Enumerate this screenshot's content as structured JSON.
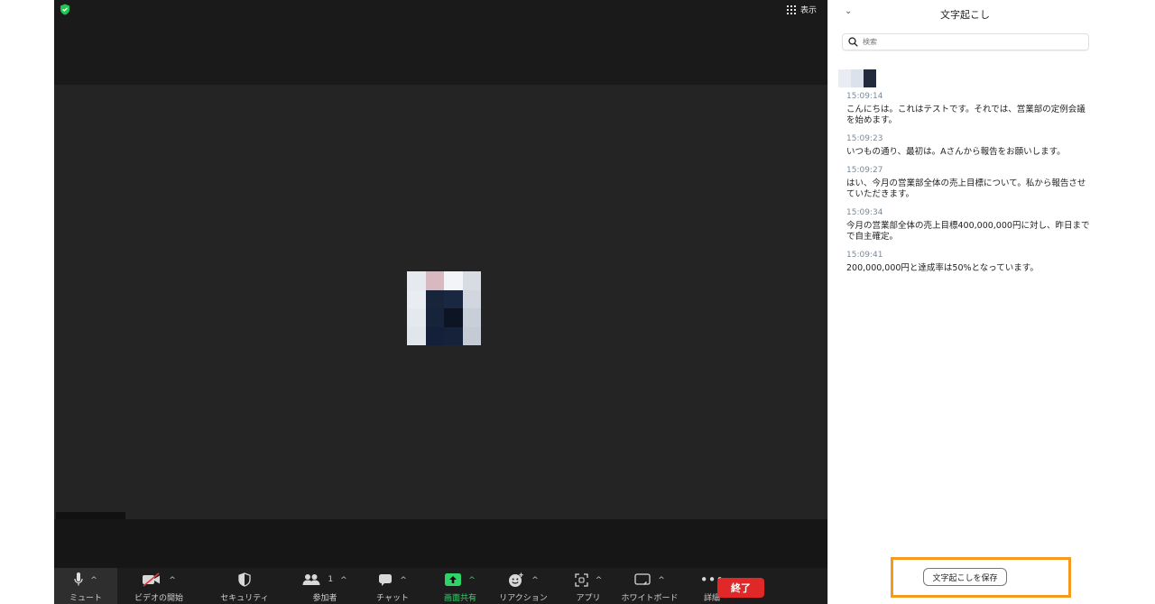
{
  "meeting": {
    "view_label": "表示",
    "avatar_colors": [
      [
        "#e6e9f0",
        "#d8b9c0",
        "#f3f4f7",
        "#d7dbe2"
      ],
      [
        "#e9ecf2",
        "#18243a",
        "#1a2740",
        "#d2d7df"
      ],
      [
        "#e4e8ef",
        "#16233a",
        "#0d1424",
        "#c9cfd8"
      ],
      [
        "#e1e6ed",
        "#142039",
        "#16213a",
        "#c4cbd5"
      ]
    ]
  },
  "toolbar": {
    "mute": "ミュート",
    "video": "ビデオの開始",
    "security": "セキュリティ",
    "participants": "参加者",
    "participants_count": "1",
    "chat": "チャット",
    "share": "画面共有",
    "reactions": "リアクション",
    "apps": "アプリ",
    "whiteboard": "ホワイトボード",
    "more": "詳細",
    "end": "終了"
  },
  "panel": {
    "title": "文字起こし",
    "search_placeholder": "検索",
    "save_label": "文字起こしを保存",
    "entries": [
      {
        "time": "15:09:14",
        "text": "こんにちは。これはテストです。それでは、営業部の定例会議を始めます。"
      },
      {
        "time": "15:09:23",
        "text": "いつもの通り、最初は。Aさんから報告をお願いします。"
      },
      {
        "time": "15:09:27",
        "text": "はい、今月の営業部全体の売上目標について。私から報告させていただきます。"
      },
      {
        "time": "15:09:34",
        "text": "今月の営業部全体の売上目標400,000,000円に対し、昨日までで自主確定。"
      },
      {
        "time": "15:09:41",
        "text": "200,000,000円と達成率は50%となっています。"
      }
    ]
  },
  "colors": {
    "end_button": "#e02828",
    "share_accent": "#3bd16f",
    "highlight_frame": "#f59a1c"
  }
}
